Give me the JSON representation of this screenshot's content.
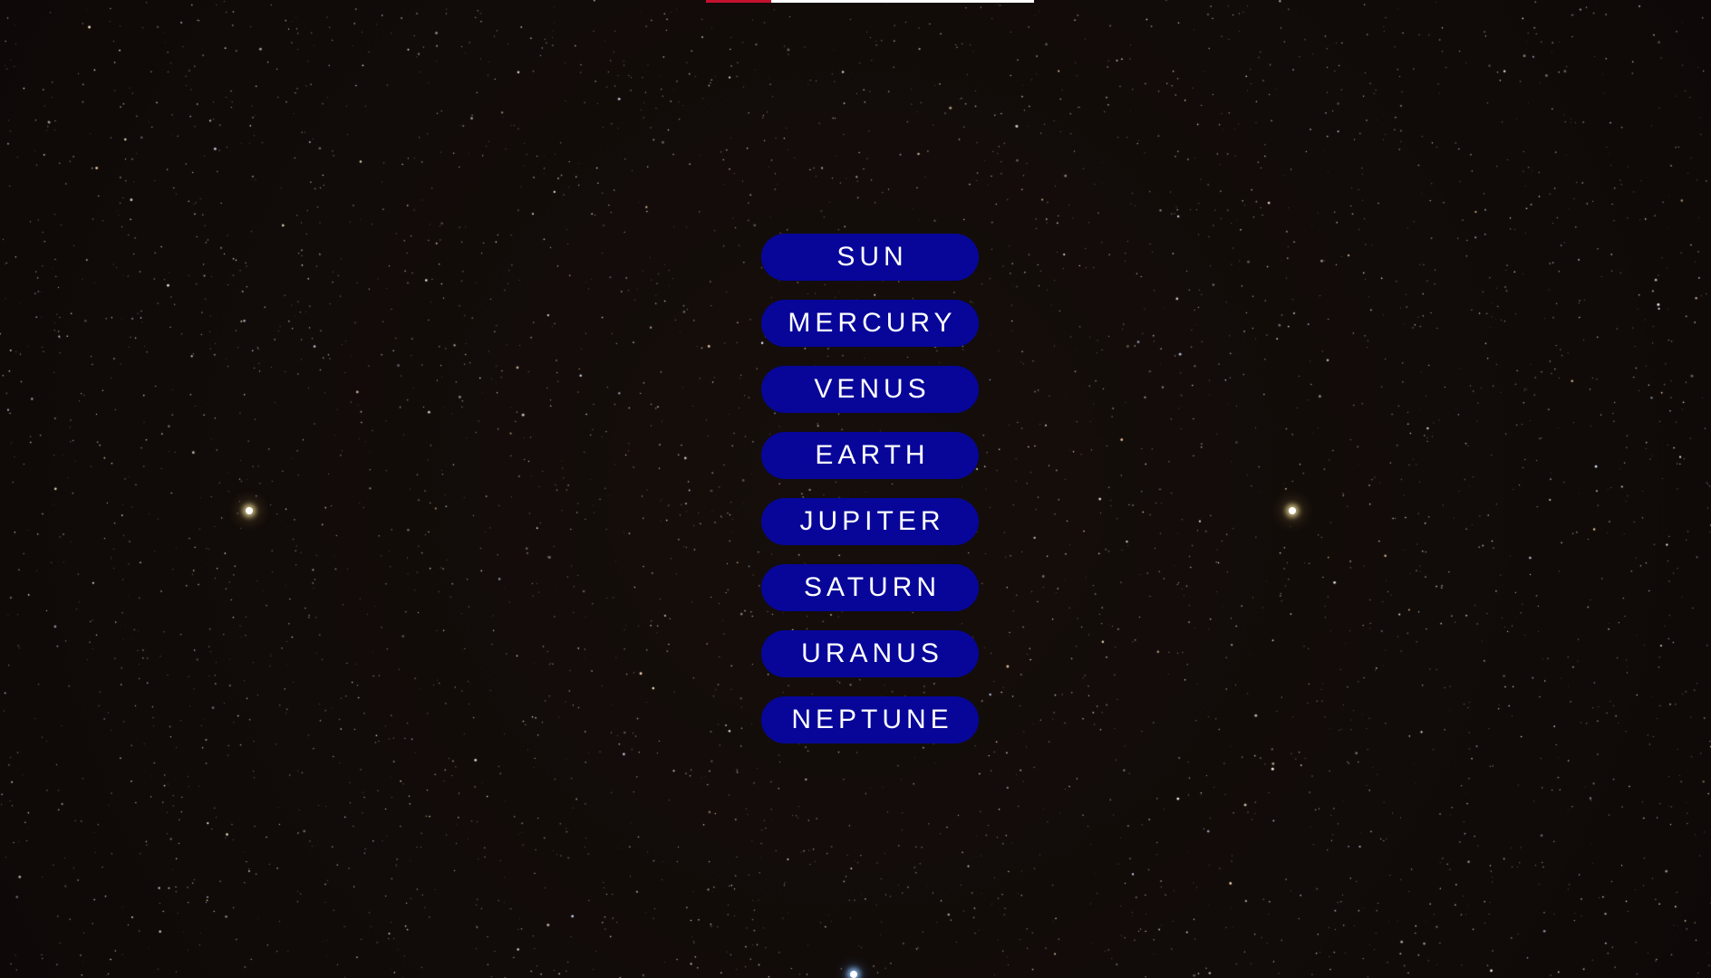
{
  "planets": [
    {
      "label": "SUN"
    },
    {
      "label": "MERCURY"
    },
    {
      "label": "VENUS"
    },
    {
      "label": "EARTH"
    },
    {
      "label": "JUPITER"
    },
    {
      "label": "SATURN"
    },
    {
      "label": "URANUS"
    },
    {
      "label": "NEPTUNE"
    }
  ],
  "colors": {
    "button_background": "#070699",
    "button_text": "#ffffff",
    "background": "#120c0a",
    "top_bar": "#ffffff",
    "top_bar_accent": "#c4122e"
  }
}
